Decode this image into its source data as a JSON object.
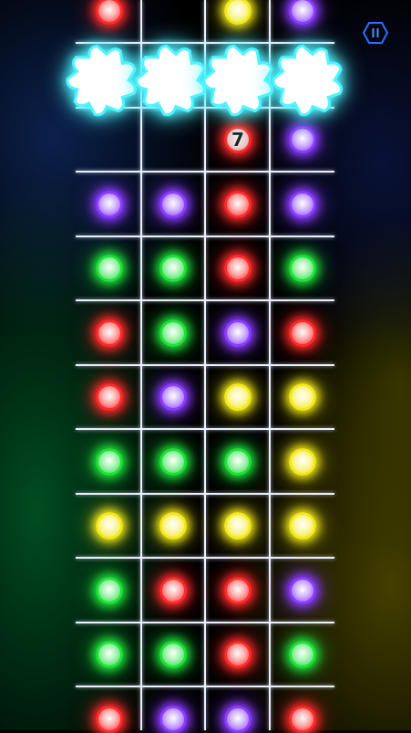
{
  "colors": {
    "red": "#ff2a2a",
    "purple": "#8a3cff",
    "green": "#1fe03a",
    "yellow": "#f2e81a",
    "grid": "#eef3ff",
    "saw": "#4ff4ff",
    "pause": "#2f6fff"
  },
  "pause_icon": "pause-hexagon-icon",
  "saw_icon": "spinning-saw-icon",
  "saw_count": 4,
  "rows": [
    [
      "red",
      "empty",
      "yellow",
      "purple"
    ],
    [
      "empty",
      "empty",
      "empty",
      "empty"
    ],
    [
      "empty",
      "empty",
      "red",
      "purple"
    ],
    [
      "purple",
      "purple",
      "red",
      "purple"
    ],
    [
      "green",
      "green",
      "red",
      "green"
    ],
    [
      "red",
      "green",
      "purple",
      "red"
    ],
    [
      "red",
      "purple",
      "yellow",
      "yellow"
    ],
    [
      "green",
      "green",
      "green",
      "yellow"
    ],
    [
      "yellow",
      "yellow",
      "yellow",
      "yellow"
    ],
    [
      "green",
      "red",
      "red",
      "purple"
    ],
    [
      "green",
      "green",
      "red",
      "green"
    ],
    [
      "red",
      "purple",
      "purple",
      "red"
    ]
  ],
  "counters": [
    {
      "row": 2,
      "col": 2,
      "value": "7"
    }
  ]
}
